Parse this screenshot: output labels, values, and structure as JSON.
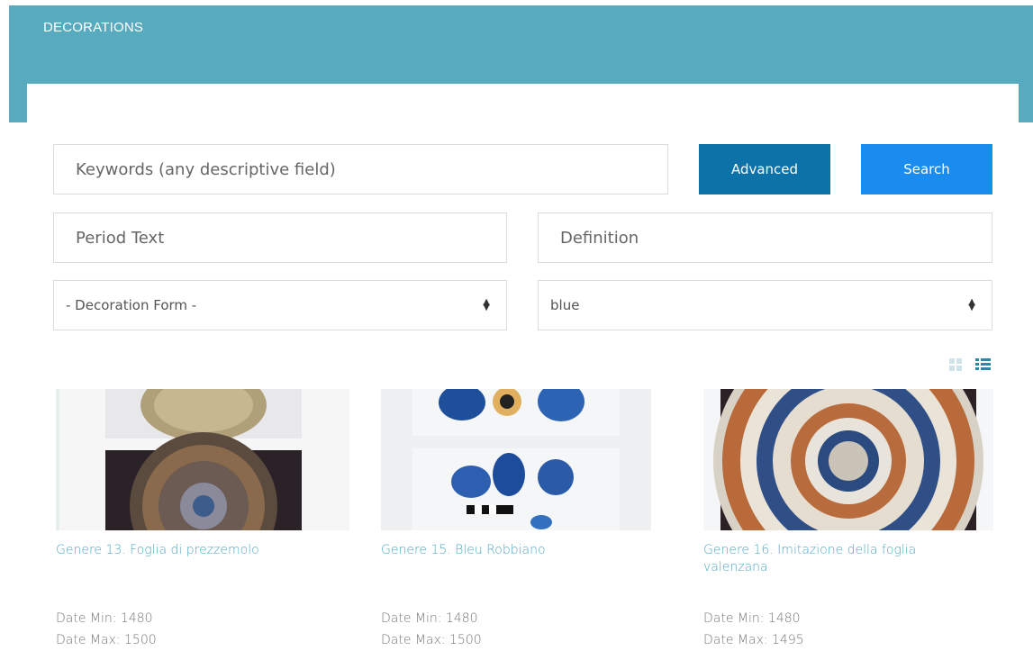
{
  "header": {
    "title": "DECORATIONS"
  },
  "search": {
    "keywords_placeholder": "Keywords (any descriptive field)",
    "advanced_label": "Advanced",
    "search_label": "Search",
    "period_placeholder": "Period Text",
    "definition_placeholder": "Definition",
    "decoration_form_value": "- Decoration Form -",
    "color_value": "blue"
  },
  "colors": {
    "header": "#58abbf",
    "advanced_button": "#0d72a8",
    "search_button": "#1a8cf0",
    "link": "#4fa9c2"
  },
  "view_toggle": {
    "grid": "grid-view-icon",
    "list": "list-view-icon"
  },
  "results": [
    {
      "title": "Genere 13. Foglia di prezzemolo",
      "date_min": "Date Min: 1480",
      "date_max": "Date Max: 1500"
    },
    {
      "title": "Genere 15. Bleu Robbiano",
      "date_min": "Date Min: 1480",
      "date_max": "Date Max: 1500"
    },
    {
      "title": "Genere 16. Imitazione della foglia valenzana",
      "date_min": "Date Min: 1480",
      "date_max": "Date Max: 1495"
    }
  ]
}
